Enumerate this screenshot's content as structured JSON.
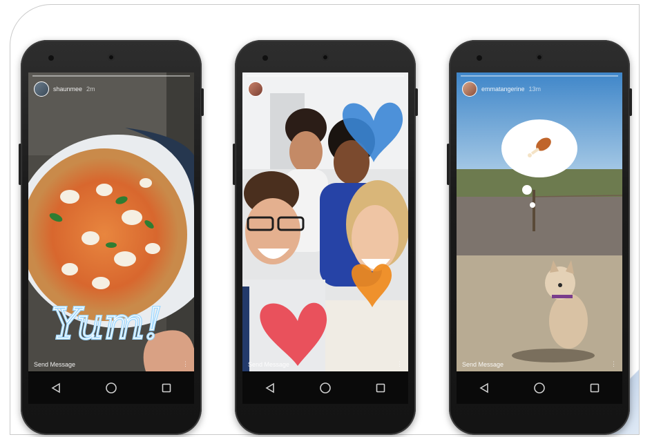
{
  "phones": [
    {
      "username": "shaunmee",
      "time": "2m",
      "send_message": "Send Message",
      "sticker_text": "Yum!",
      "scene": "pizza"
    },
    {
      "username": "",
      "time": "",
      "send_message": "Send Message",
      "scene": "selfie-with-hearts"
    },
    {
      "username": "emmatangerine",
      "time": "13m",
      "send_message": "Send Message",
      "scene": "dog-with-drumstick-bubble"
    }
  ],
  "navbar": {
    "back_icon": "back-triangle-icon",
    "home_icon": "home-circle-icon",
    "recents_icon": "recents-square-icon"
  },
  "colors": {
    "phone_body": "#1a1a1a",
    "yum_stroke": "#9fd8ff",
    "heart_blue": "#3b86d6",
    "heart_red": "#e8434f",
    "heart_orange": "#f08a1c"
  }
}
